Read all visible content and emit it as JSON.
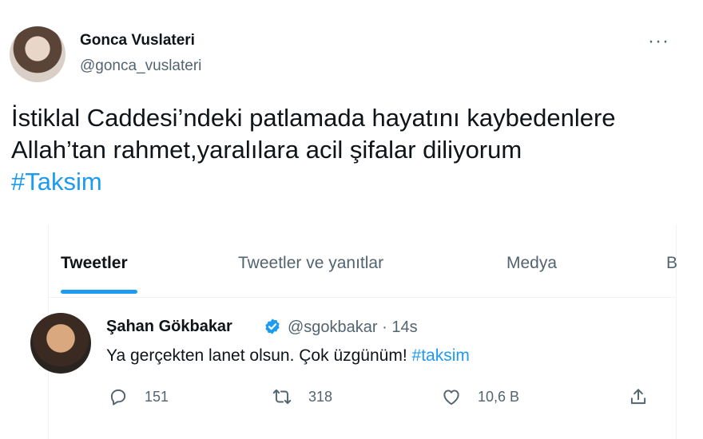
{
  "top_tweet": {
    "name": "Gonca Vuslateri",
    "handle": "@gonca_vuslateri",
    "more": "···",
    "text_line1": "İstiklal Caddesi’ndeki patlamada hayatını kaybedenlere",
    "text_line2": "Allah’tan rahmet,yaralılara acil şifalar diliyorum",
    "hashtag": "#Taksim"
  },
  "tabs": [
    "Tweetler",
    "Tweetler ve yanıtlar",
    "Medya",
    "B"
  ],
  "reply_tweet": {
    "name": "Şahan Gökbakar",
    "handle_time": "@sgokbakar · 14s",
    "text": "Ya gerçekten lanet olsun. Çok üzgünüm! ",
    "hashtag": "#taksim",
    "reply_count": "151",
    "retweet_count": "318",
    "like_count": "10,6 B"
  },
  "colors": {
    "accent": "#1d9bf0",
    "secondary_text": "#536471"
  }
}
